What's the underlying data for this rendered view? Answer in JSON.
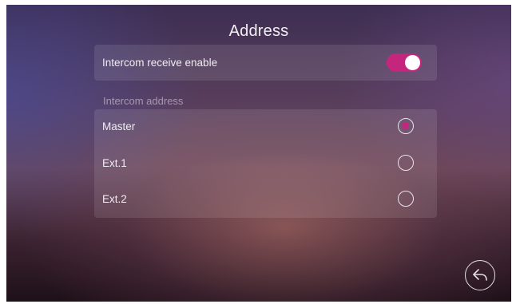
{
  "header": {
    "title": "Address"
  },
  "enable": {
    "label": "Intercom receive enable",
    "state": "on"
  },
  "address": {
    "section_label": "Intercom address",
    "options": [
      {
        "label": "Master",
        "selected": true
      },
      {
        "label": "Ext.1",
        "selected": false
      },
      {
        "label": "Ext.2",
        "selected": false
      }
    ]
  },
  "controls": {
    "back_icon": "back-arrow-icon"
  },
  "colors": {
    "accent": "#c4267e",
    "text": "#f0ecf2",
    "muted_text": "#b5a9bd"
  }
}
